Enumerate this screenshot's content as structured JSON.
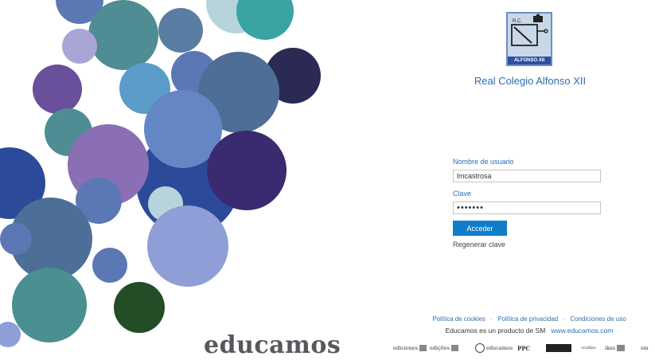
{
  "school": {
    "name": "Real Colegio Alfonso XII",
    "logo_top_text": "R.C.",
    "logo_bottom_text": "ALFONSO XII"
  },
  "login": {
    "username_label": "Nombre de usuario",
    "username_value": "lmcastrosa",
    "password_label": "Clave",
    "password_value": "•••••••",
    "submit_label": "Acceder",
    "regenerate_label": "Regenerar clave"
  },
  "footer": {
    "links": [
      "Política de cookies",
      "Política de privacidad",
      "Condiciones de uso"
    ],
    "separator": "·",
    "product_text": "Educamos es un producto de SM",
    "website": "www.educamos.com"
  },
  "brand": {
    "wordmark": "educamos"
  },
  "partners": [
    "ediciones",
    "edições",
    "educamos",
    "PPC",
    "",
    "cruilles",
    "ikas",
    "sm"
  ],
  "colors": {
    "accent_text": "#2f6db3",
    "button": "#0f7dc9",
    "wordmark": "#55585c"
  }
}
